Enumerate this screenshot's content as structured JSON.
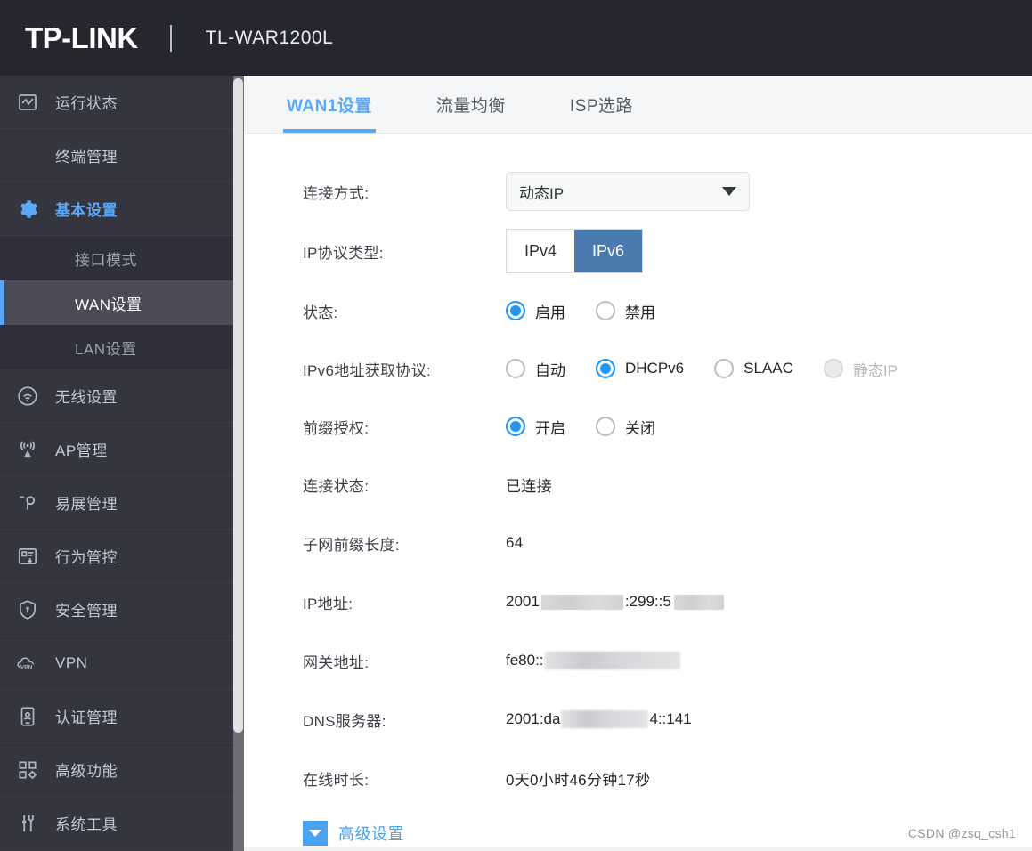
{
  "header": {
    "logo": "TP-LINK",
    "model": "TL-WAR1200L"
  },
  "sidebar": {
    "items": [
      {
        "label": "运行状态",
        "icon": "chart-square-icon",
        "active": false,
        "has_icon": true
      },
      {
        "label": "终端管理",
        "icon": "",
        "active": false,
        "has_icon": false
      },
      {
        "label": "基本设置",
        "icon": "gear-icon",
        "active": true,
        "has_icon": true
      },
      {
        "label": "无线设置",
        "icon": "wifi-icon",
        "active": false,
        "has_icon": true
      },
      {
        "label": "AP管理",
        "icon": "antenna-icon",
        "active": false,
        "has_icon": true
      },
      {
        "label": "易展管理",
        "icon": "mesh-icon",
        "active": false,
        "has_icon": true
      },
      {
        "label": "行为管控",
        "icon": "behavior-control-icon",
        "active": false,
        "has_icon": true
      },
      {
        "label": "安全管理",
        "icon": "shield-lock-icon",
        "active": false,
        "has_icon": true
      },
      {
        "label": "VPN",
        "icon": "vpn-cloud-icon",
        "active": false,
        "has_icon": true
      },
      {
        "label": "认证管理",
        "icon": "id-card-icon",
        "active": false,
        "has_icon": true
      },
      {
        "label": "高级功能",
        "icon": "grid-gear-icon",
        "active": false,
        "has_icon": true
      },
      {
        "label": "系统工具",
        "icon": "tools-icon",
        "active": false,
        "has_icon": true
      }
    ],
    "subitems": [
      {
        "label": "接口模式",
        "selected": false
      },
      {
        "label": "WAN设置",
        "selected": true
      },
      {
        "label": "LAN设置",
        "selected": false
      }
    ]
  },
  "tabs": [
    {
      "label": "WAN1设置",
      "active": true
    },
    {
      "label": "流量均衡",
      "active": false
    },
    {
      "label": "ISP选路",
      "active": false
    }
  ],
  "form": {
    "connection_mode": {
      "label": "连接方式:",
      "value": "动态IP"
    },
    "ip_protocol": {
      "label": "IP协议类型:",
      "options": [
        "IPv4",
        "IPv6"
      ],
      "selected": "IPv6"
    },
    "status": {
      "label": "状态:",
      "options": [
        "启用",
        "禁用"
      ],
      "selected": "启用"
    },
    "ipv6_acquire": {
      "label": "IPv6地址获取协议:",
      "options": [
        "自动",
        "DHCPv6",
        "SLAAC",
        "静态IP"
      ],
      "selected": "DHCPv6",
      "disabled": [
        "静态IP"
      ]
    },
    "prefix_delegation": {
      "label": "前缀授权:",
      "options": [
        "开启",
        "关闭"
      ],
      "selected": "开启"
    },
    "connection_status": {
      "label": "连接状态:",
      "value": "已连接"
    },
    "prefix_length": {
      "label": "子网前缀长度:",
      "value": "64"
    },
    "ip_address": {
      "label": "IP地址:",
      "prefix": "2001",
      "middle": ":299::5",
      "suffix": ""
    },
    "gateway": {
      "label": "网关地址:",
      "prefix": "fe80::",
      "middle": "",
      "suffix": ""
    },
    "dns": {
      "label": "DNS服务器:",
      "prefix": "2001:da",
      "middle": "",
      "suffix": "4::141"
    },
    "online_time": {
      "label": "在线时长:",
      "value": "0天0小时46分钟17秒"
    }
  },
  "advanced": {
    "label": "高级设置"
  },
  "watermark": "CSDN @zsq_csh1",
  "colors": {
    "header_bg": "#26262f",
    "sidebar_bg": "#34353f",
    "sidebar_sub_bg": "#2e2f3a",
    "accent_blue": "#5aa9f8",
    "radio_blue": "#2196f3",
    "segment_blue": "#4a7ab0"
  }
}
